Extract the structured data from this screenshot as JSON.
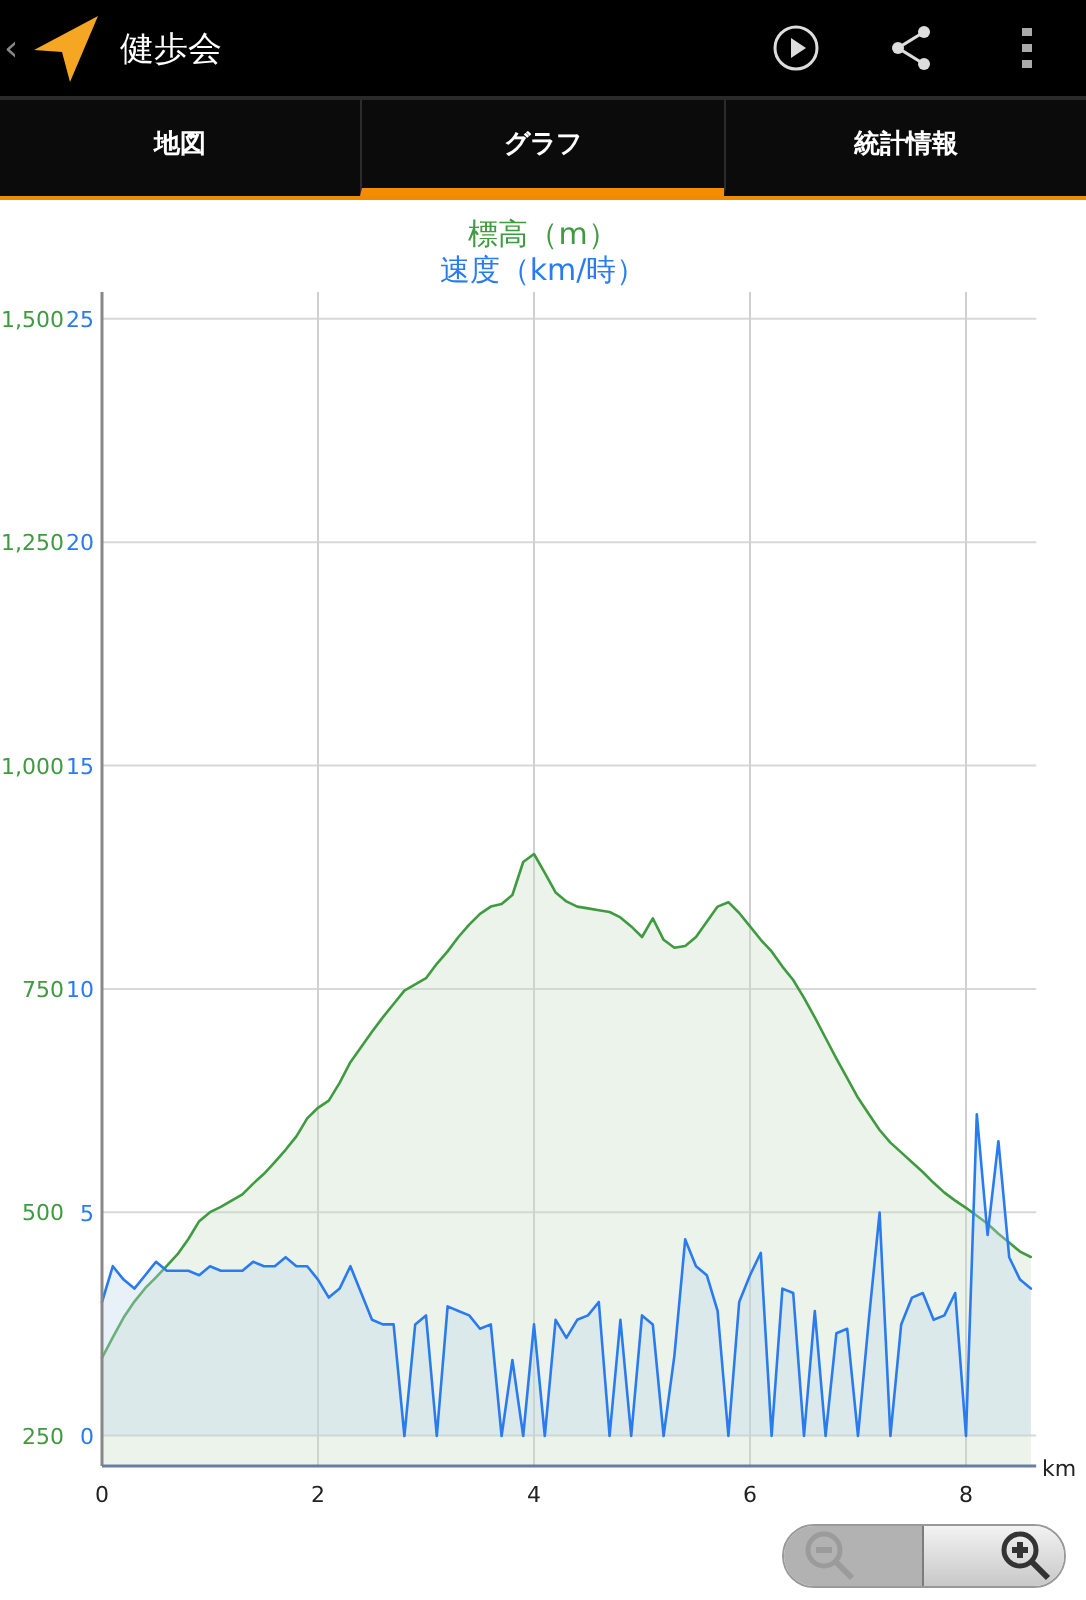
{
  "app_bar": {
    "back": "‹",
    "title": "健歩会"
  },
  "tabs": [
    {
      "label": "地図",
      "selected": false
    },
    {
      "label": "グラフ",
      "selected": true
    },
    {
      "label": "統計情報",
      "selected": false
    }
  ],
  "chart": {
    "chart_data": {
      "type": "area",
      "xlabel": "km",
      "xlim": [
        0,
        8.65
      ],
      "xticks": [
        0,
        2,
        4,
        6,
        8
      ],
      "ylim": [
        216,
        1530
      ],
      "yticks": [
        {
          "value": 250,
          "label": "250"
        },
        {
          "value": 500,
          "label": "500"
        },
        {
          "value": 750,
          "label": "750"
        },
        {
          "value": 1000,
          "label": "1,000"
        },
        {
          "value": 1250,
          "label": "1,250"
        },
        {
          "value": 1500,
          "label": "1,500"
        }
      ],
      "y2ticks": [
        0,
        5,
        10,
        15,
        20,
        25
      ],
      "y2lim": [
        -0.67,
        25.6
      ],
      "grid": true,
      "x": [
        0,
        0.1,
        0.2,
        0.3,
        0.4,
        0.5,
        0.6,
        0.7,
        0.8,
        0.9,
        1,
        1.1,
        1.2,
        1.3,
        1.4,
        1.5,
        1.6,
        1.7,
        1.8,
        1.9,
        2,
        2.1,
        2.2,
        2.3,
        2.4,
        2.5,
        2.6,
        2.7,
        2.8,
        2.9,
        3,
        3.1,
        3.2,
        3.3,
        3.4,
        3.5,
        3.6,
        3.7,
        3.8,
        3.9,
        4,
        4.1,
        4.2,
        4.3,
        4.4,
        4.5,
        4.6,
        4.7,
        4.8,
        4.9,
        5,
        5.1,
        5.2,
        5.3,
        5.4,
        5.5,
        5.6,
        5.7,
        5.8,
        5.9,
        6,
        6.1,
        6.2,
        6.3,
        6.4,
        6.5,
        6.6,
        6.7,
        6.8,
        6.9,
        7,
        7.1,
        7.2,
        7.3,
        7.4,
        7.5,
        7.6,
        7.7,
        7.8,
        7.9,
        8,
        8.1,
        8.2,
        8.3,
        8.4,
        8.5,
        8.6
      ],
      "series": [
        {
          "name": "標高（m）",
          "color": "#3f9b3f",
          "values": [
            337,
            360,
            382,
            400,
            415,
            427,
            440,
            453,
            470,
            490,
            500,
            506,
            513,
            520,
            532,
            543,
            556,
            570,
            585,
            605,
            617,
            625,
            645,
            668,
            685,
            702,
            718,
            733,
            748,
            755,
            762,
            778,
            792,
            808,
            822,
            834,
            842,
            845,
            855,
            892,
            901,
            880,
            858,
            848,
            842,
            840,
            838,
            836,
            830,
            820,
            808,
            829,
            805,
            796,
            798,
            808,
            825,
            842,
            847,
            835,
            820,
            805,
            792,
            775,
            760,
            740,
            718,
            695,
            672,
            650,
            628,
            610,
            592,
            578,
            567,
            556,
            545,
            533,
            522,
            513,
            505,
            496,
            487,
            476,
            466,
            456,
            450
          ]
        },
        {
          "name": "速度（km/時）",
          "color": "#2a7bf0",
          "axis": "y2",
          "values": [
            3.0,
            3.8,
            3.5,
            3.3,
            3.6,
            3.9,
            3.7,
            3.7,
            3.7,
            3.6,
            3.8,
            3.7,
            3.7,
            3.7,
            3.9,
            3.8,
            3.8,
            4.0,
            3.8,
            3.8,
            3.5,
            3.1,
            3.3,
            3.8,
            3.2,
            2.6,
            2.5,
            2.5,
            0,
            2.5,
            2.7,
            0,
            2.9,
            2.8,
            2.7,
            2.4,
            2.5,
            0,
            1.7,
            0,
            2.5,
            0,
            2.6,
            2.2,
            2.6,
            2.7,
            3.0,
            0,
            2.6,
            0,
            2.7,
            2.5,
            0,
            1.8,
            4.4,
            3.8,
            3.6,
            2.8,
            0,
            3.0,
            3.6,
            4.1,
            0,
            3.3,
            3.2,
            0,
            2.8,
            0,
            2.3,
            2.4,
            0,
            2.6,
            5.0,
            0,
            2.5,
            3.1,
            3.2,
            2.6,
            2.7,
            3.2,
            0,
            7.2,
            4.5,
            6.6,
            4.0,
            3.5,
            3.3
          ]
        }
      ]
    }
  },
  "zoom": {
    "zoom_out_disabled": true
  }
}
